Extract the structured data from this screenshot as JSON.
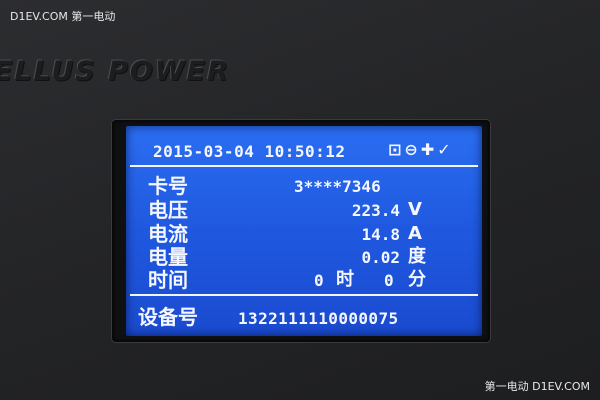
{
  "watermarks": {
    "top_left": "D1EV.COM 第一电动",
    "bottom_right": "第一电动 D1EV.COM"
  },
  "brand": {
    "text": "ELLUS POWER"
  },
  "screen": {
    "datetime": "2015-03-04 10:50:12",
    "status_icons": [
      {
        "name": "lock-icon",
        "glyph": "⊡"
      },
      {
        "name": "plug-icon",
        "glyph": "⊖"
      },
      {
        "name": "antenna-icon",
        "glyph": "✚"
      },
      {
        "name": "check-icon",
        "glyph": "✓"
      }
    ],
    "rows": [
      {
        "label": "卡号",
        "value": "3****7346",
        "unit": ""
      },
      {
        "label": "电压",
        "value": "223.4",
        "unit": "V"
      },
      {
        "label": "电流",
        "value": "14.8",
        "unit": "A"
      },
      {
        "label": "电量",
        "value": "0.02",
        "unit": "度"
      },
      {
        "label": "时间",
        "value": "",
        "unit": ""
      }
    ],
    "time": {
      "hours": "0",
      "hours_unit": "时",
      "minutes": "0",
      "minutes_unit": "分"
    },
    "device": {
      "label": "设备号",
      "value": "1322111110000075"
    },
    "colors": {
      "lcd_background": "#2063e8",
      "lcd_text": "#f4f7ff"
    }
  }
}
